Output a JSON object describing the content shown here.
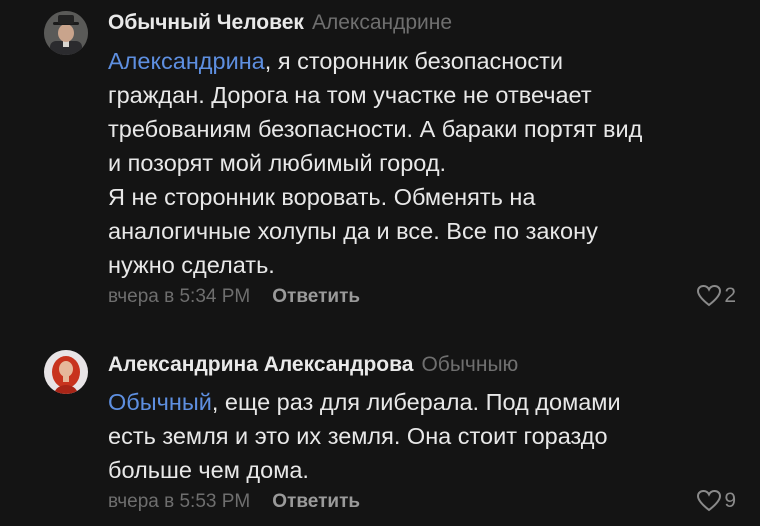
{
  "comments": [
    {
      "author": "Обычный Человек",
      "reply_to": "Александрине",
      "mention": "Александрина",
      "lines": [
        ", я сторонник безопасности",
        "граждан. Дорога на том участке не отвечает",
        "требованиям безопасности. А бараки портят вид",
        "и позорят мой любимый город.",
        "Я не сторонник воровать. Обменять на",
        "аналогичные холупы да и все. Все по закону",
        "нужно сделать."
      ],
      "timestamp": "вчера в 5:34 PM",
      "reply_label": "Ответить",
      "likes": "2",
      "avatar_icon": "man-in-hat-avatar"
    },
    {
      "author": "Александрина Александрова",
      "reply_to": "Обычныю",
      "mention": "Обычный",
      "lines": [
        ", еще раз для либерала. Под домами",
        "есть земля и это их земля. Она стоит гораздо",
        "больше чем дома."
      ],
      "timestamp": "вчера в 5:53 PM",
      "reply_label": "Ответить",
      "likes": "9",
      "avatar_icon": "red-haired-woman-avatar"
    }
  ],
  "colors": {
    "background": "#141414",
    "mention": "#5e8fe0",
    "muted": "#6e6e6e"
  }
}
